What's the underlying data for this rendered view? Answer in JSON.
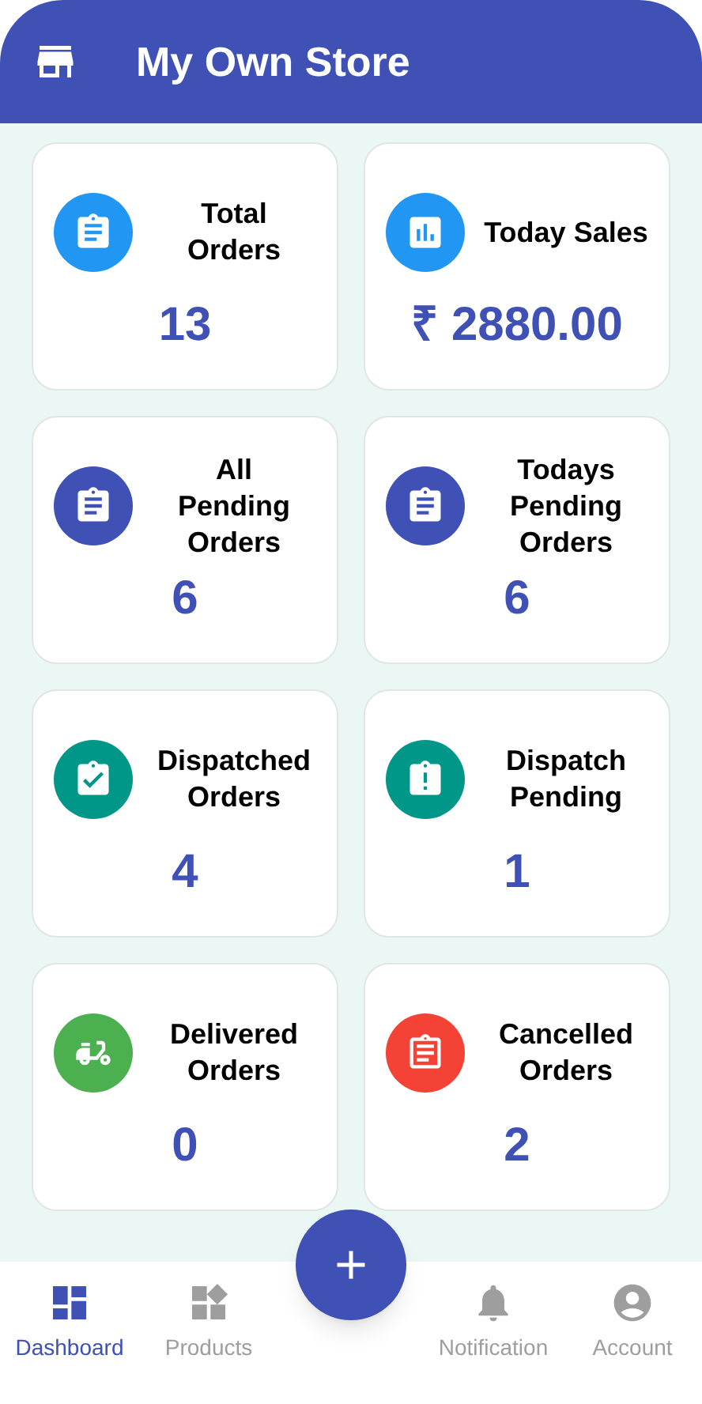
{
  "app_bar": {
    "title": "My Own Store"
  },
  "cards": [
    {
      "title": "Total Orders",
      "value": "13",
      "kind": "list",
      "color": "#2196f3"
    },
    {
      "title": "Today Sales",
      "value": "₹ 2880.00",
      "kind": "chart",
      "color": "#2196f3"
    },
    {
      "title": "All\nPending Orders",
      "value": "6",
      "kind": "list",
      "color": "#3f51b5"
    },
    {
      "title": "Todays Pending Orders",
      "value": "6",
      "kind": "list",
      "color": "#3f51b5"
    },
    {
      "title": "Dispatched Orders",
      "value": "4",
      "kind": "check",
      "color": "#009688"
    },
    {
      "title": "Dispatch Pending",
      "value": "1",
      "kind": "alert",
      "color": "#009688"
    },
    {
      "title": "Delivered Orders",
      "value": "0",
      "kind": "scooter",
      "color": "#4caf50"
    },
    {
      "title": "Cancelled Orders",
      "value": "2",
      "kind": "outline",
      "color": "#f44336"
    }
  ],
  "bottom_nav": [
    {
      "label": "Dashboard",
      "kind": "dashboard",
      "selected": true
    },
    {
      "label": "Products",
      "kind": "widgets",
      "selected": false
    },
    {
      "label": "Notification",
      "kind": "bell",
      "selected": false
    },
    {
      "label": "Account",
      "kind": "account",
      "selected": false
    }
  ]
}
